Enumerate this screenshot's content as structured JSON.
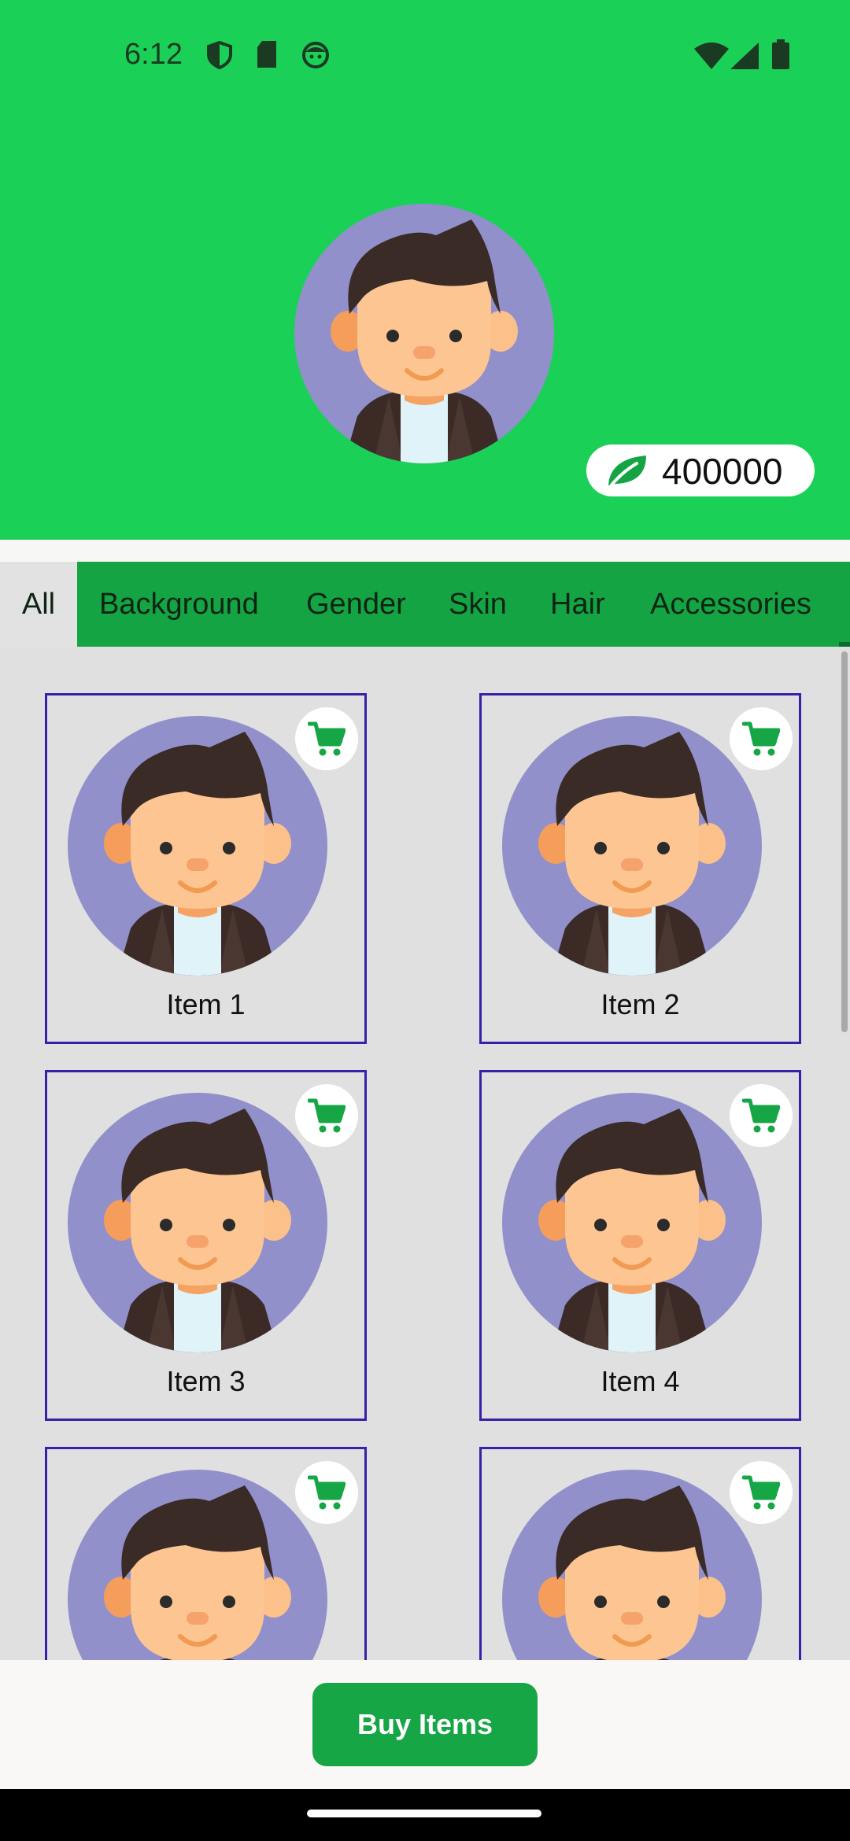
{
  "status_bar": {
    "time": "6:12"
  },
  "profile": {
    "coins": "400000"
  },
  "tabs": [
    {
      "label": "All",
      "selected": true
    },
    {
      "label": "Background",
      "selected": false
    },
    {
      "label": "Gender",
      "selected": false
    },
    {
      "label": "Skin",
      "selected": false
    },
    {
      "label": "Hair",
      "selected": false
    },
    {
      "label": "Accessories",
      "selected": false
    }
  ],
  "items": [
    {
      "label": "Item 1"
    },
    {
      "label": "Item 2"
    },
    {
      "label": "Item 3"
    },
    {
      "label": "Item 4"
    },
    {
      "label": ""
    },
    {
      "label": ""
    }
  ],
  "bottom": {
    "buy_label": "Buy Items"
  },
  "colors": {
    "brand_green": "#1bd057",
    "tab_green": "#15a444",
    "button_green": "#16a646",
    "card_border": "#3b1fa8"
  },
  "icons": [
    "shield-icon",
    "sd-card-icon",
    "face-icon",
    "wifi-icon",
    "signal-icon",
    "battery-icon",
    "leaf-icon",
    "cart-icon"
  ]
}
